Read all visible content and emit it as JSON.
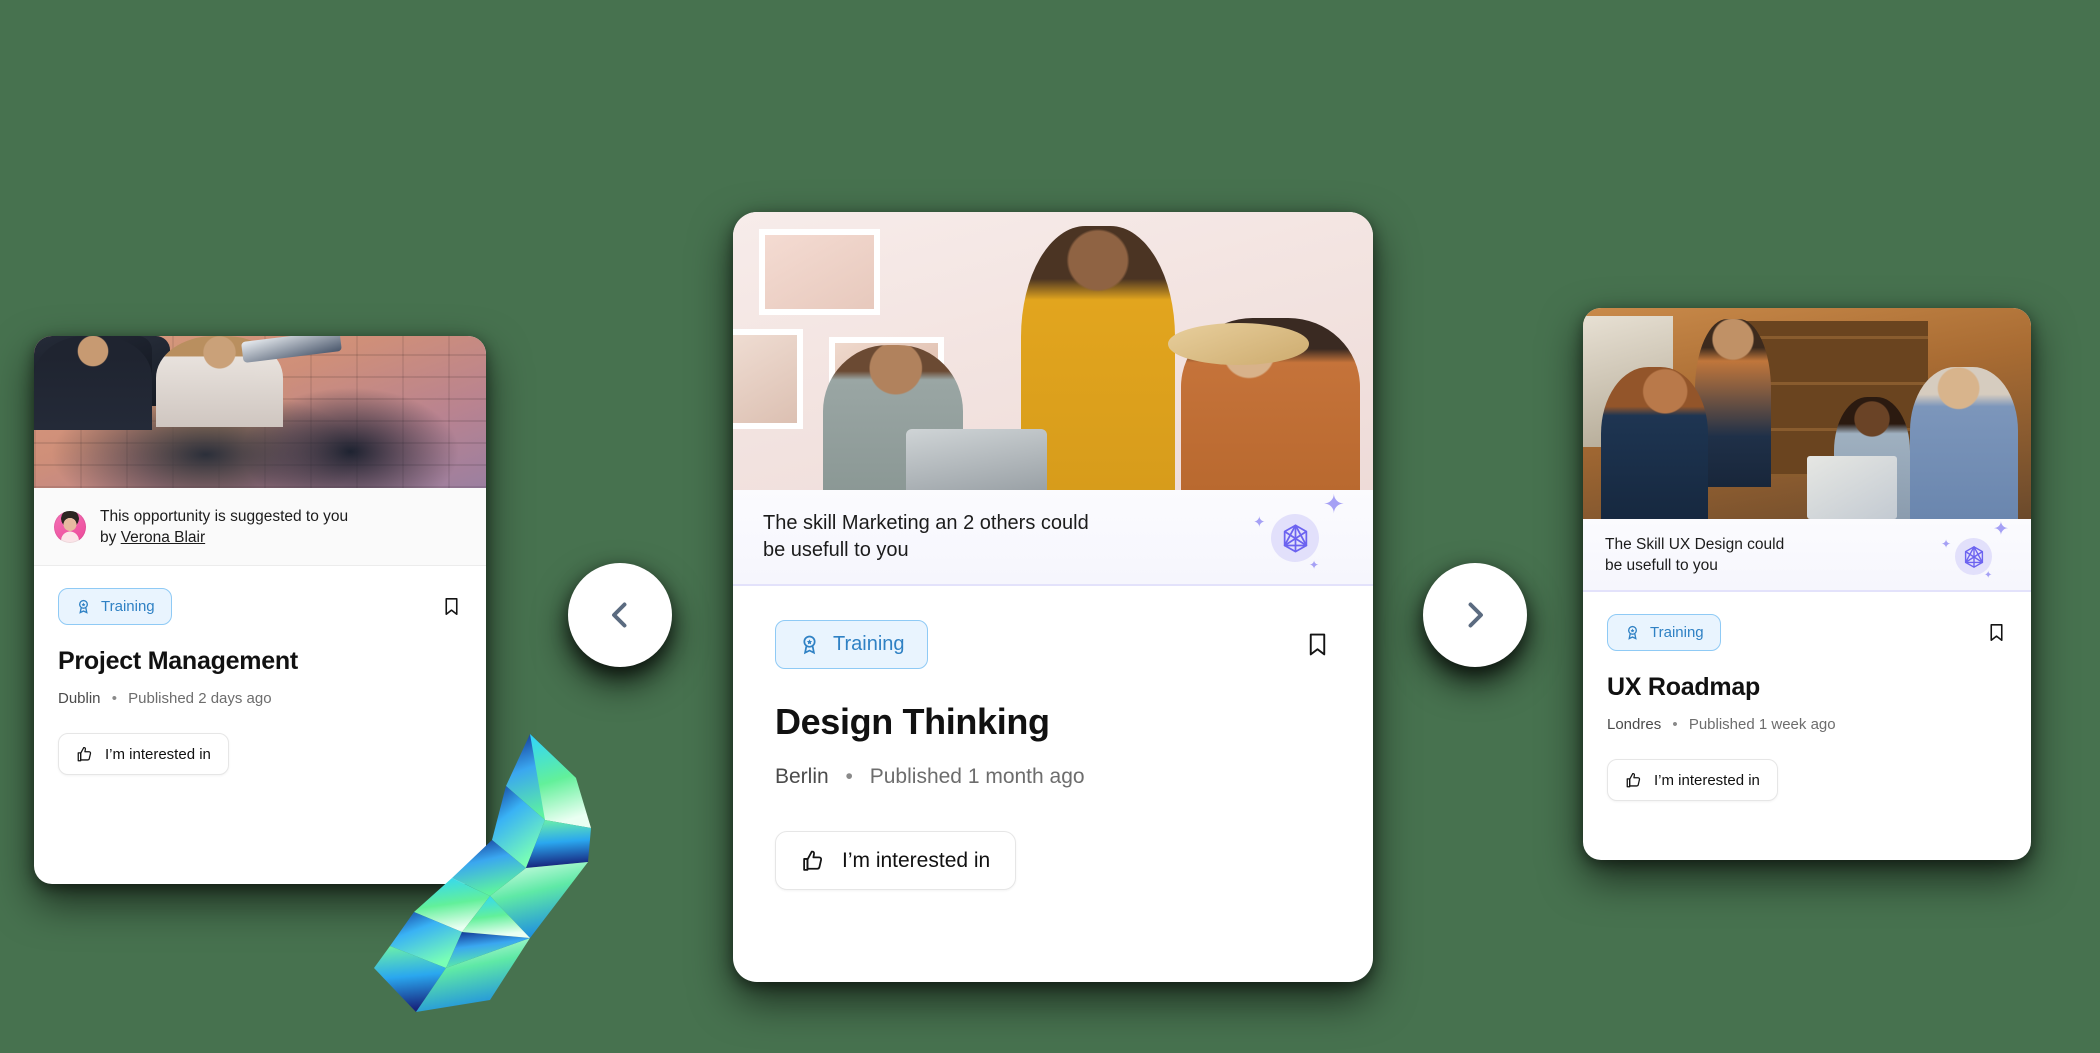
{
  "page": {
    "background_color": "#47724f",
    "accent_blue": "#2f81c4",
    "accent_purple": "#6c63f0",
    "card_background": "#ffffff"
  },
  "carousel": {
    "prev_button": {
      "icon": "chevron-left-icon",
      "label": "Previous"
    },
    "next_button": {
      "icon": "chevron-right-icon",
      "label": "Next"
    }
  },
  "decoration": {
    "gem": "faceted-gem-decoration"
  },
  "cards": [
    {
      "id": "project-management",
      "photo": "two-women-meeting-brick-wall",
      "banner": {
        "type": "person-suggestion",
        "avatar": "verona-blair-avatar",
        "line1": "This opportunity is suggested to you",
        "line2_prefix": "by ",
        "person": "Verona Blair"
      },
      "pill": {
        "icon": "award-icon",
        "label": "Training"
      },
      "bookmark": {
        "icon": "bookmark-icon"
      },
      "title": "Project Management",
      "location": "Dublin",
      "separator": "•",
      "published": "Published 2 days ago",
      "cta": {
        "icon": "thumbs-up-icon",
        "label": "I’m interested in"
      }
    },
    {
      "id": "design-thinking",
      "photo": "three-women-laptop-studio",
      "banner": {
        "type": "ai-suggestion",
        "icon": "ai-gem-icon",
        "line1": "The skill Marketing an 2 others could",
        "line2": "be usefull to you"
      },
      "pill": {
        "icon": "award-icon",
        "label": "Training"
      },
      "bookmark": {
        "icon": "bookmark-icon"
      },
      "title": "Design Thinking",
      "location": "Berlin",
      "separator": "•",
      "published": "Published 1 month ago",
      "cta": {
        "icon": "thumbs-up-icon",
        "label": "I’m interested in"
      }
    },
    {
      "id": "ux-roadmap",
      "photo": "team-meeting-library",
      "banner": {
        "type": "ai-suggestion",
        "icon": "ai-gem-icon",
        "line1": "The Skill UX Design could",
        "line2": "be usefull to you"
      },
      "pill": {
        "icon": "award-icon",
        "label": "Training"
      },
      "bookmark": {
        "icon": "bookmark-icon"
      },
      "title": "UX Roadmap",
      "location": "Londres",
      "separator": "•",
      "published": "Published 1 week ago",
      "cta": {
        "icon": "thumbs-up-icon",
        "label": "I’m interested in"
      }
    }
  ]
}
